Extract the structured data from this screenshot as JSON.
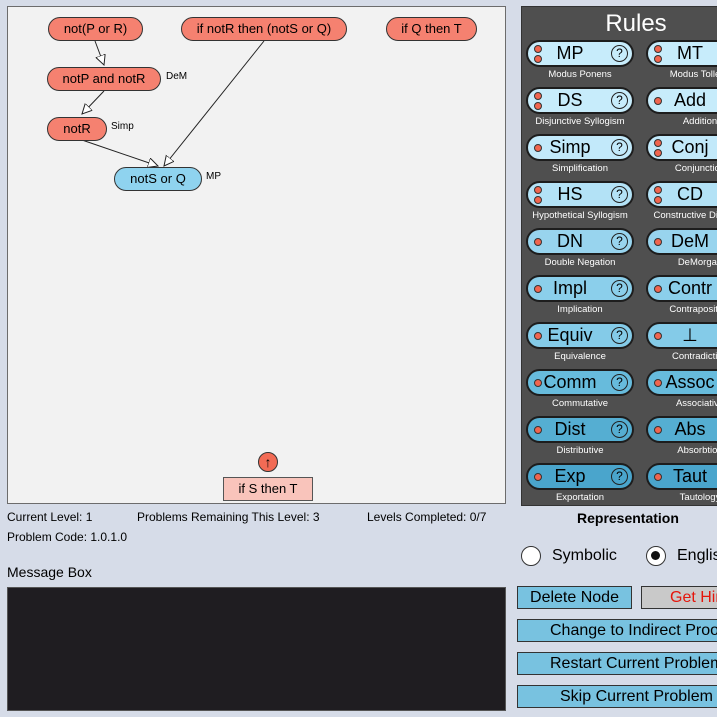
{
  "proof": {
    "premises": [
      "not(P or R)",
      "if notR then (notS or Q)",
      "if Q then T"
    ],
    "derived": [
      {
        "text": "notP and notR",
        "rule": "DeM"
      },
      {
        "text": "notR",
        "rule": "Simp"
      },
      {
        "text": "notS or Q",
        "rule": "MP"
      }
    ],
    "goal": "if S then T",
    "goal_arrow": "↑"
  },
  "rules_panel": {
    "title": "Rules",
    "help_symbol": "?",
    "rules": [
      {
        "abbr": "MP",
        "name": "Modus Ponens",
        "dots": 2
      },
      {
        "abbr": "MT",
        "name": "Modus Tollens",
        "dots": 2
      },
      {
        "abbr": "DS",
        "name": "Disjunctive Syllogism",
        "dots": 2
      },
      {
        "abbr": "Add",
        "name": "Addition",
        "dots": 1
      },
      {
        "abbr": "Simp",
        "name": "Simplification",
        "dots": 1
      },
      {
        "abbr": "Conj",
        "name": "Conjunction",
        "dots": 2
      },
      {
        "abbr": "HS",
        "name": "Hypothetical Syllogism",
        "dots": 2
      },
      {
        "abbr": "CD",
        "name": "Constructive Dilemma",
        "dots": 2
      },
      {
        "abbr": "DN",
        "name": "Double Negation",
        "dots": 1
      },
      {
        "abbr": "DeM",
        "name": "DeMorgan",
        "dots": 1
      },
      {
        "abbr": "Impl",
        "name": "Implication",
        "dots": 1
      },
      {
        "abbr": "Contr",
        "name": "Contraposition",
        "dots": 1
      },
      {
        "abbr": "Equiv",
        "name": "Equivalence",
        "dots": 1
      },
      {
        "abbr": "⊥",
        "name": "Contradiction",
        "dots": 1
      },
      {
        "abbr": "Comm",
        "name": "Commutative",
        "dots": 1
      },
      {
        "abbr": "Assoc",
        "name": "Associative",
        "dots": 1
      },
      {
        "abbr": "Dist",
        "name": "Distributive",
        "dots": 1
      },
      {
        "abbr": "Abs",
        "name": "Absorbtion",
        "dots": 1
      },
      {
        "abbr": "Exp",
        "name": "Exportation",
        "dots": 1
      },
      {
        "abbr": "Taut",
        "name": "Tautology",
        "dots": 1
      }
    ]
  },
  "status": {
    "current_level": "Current Level: 1",
    "problems_remaining": "Problems Remaining This Level: 3",
    "levels_completed": "Levels Completed: 0/7",
    "problem_code": "Problem Code: 1.0.1.0"
  },
  "representation": {
    "title": "Representation",
    "symbolic_label": "Symbolic",
    "english_label": "English",
    "selected": "English"
  },
  "message_box": {
    "title": "Message Box",
    "content": ""
  },
  "actions": {
    "delete_node": "Delete Node",
    "get_hint": "Get Hint",
    "change_indirect": "Change to Indirect Proof",
    "restart": "Restart Current Problem",
    "skip": "Skip Current Problem"
  },
  "colors": {
    "premise_node": "#f58170",
    "derived_node": "#8fd3ef",
    "goal_node": "#f9c4bb",
    "rules_panel_bg": "#4f4f4f",
    "message_box_bg": "#1f1d21",
    "action_button": "#78c2e0",
    "hint_text": "#e5150b"
  }
}
